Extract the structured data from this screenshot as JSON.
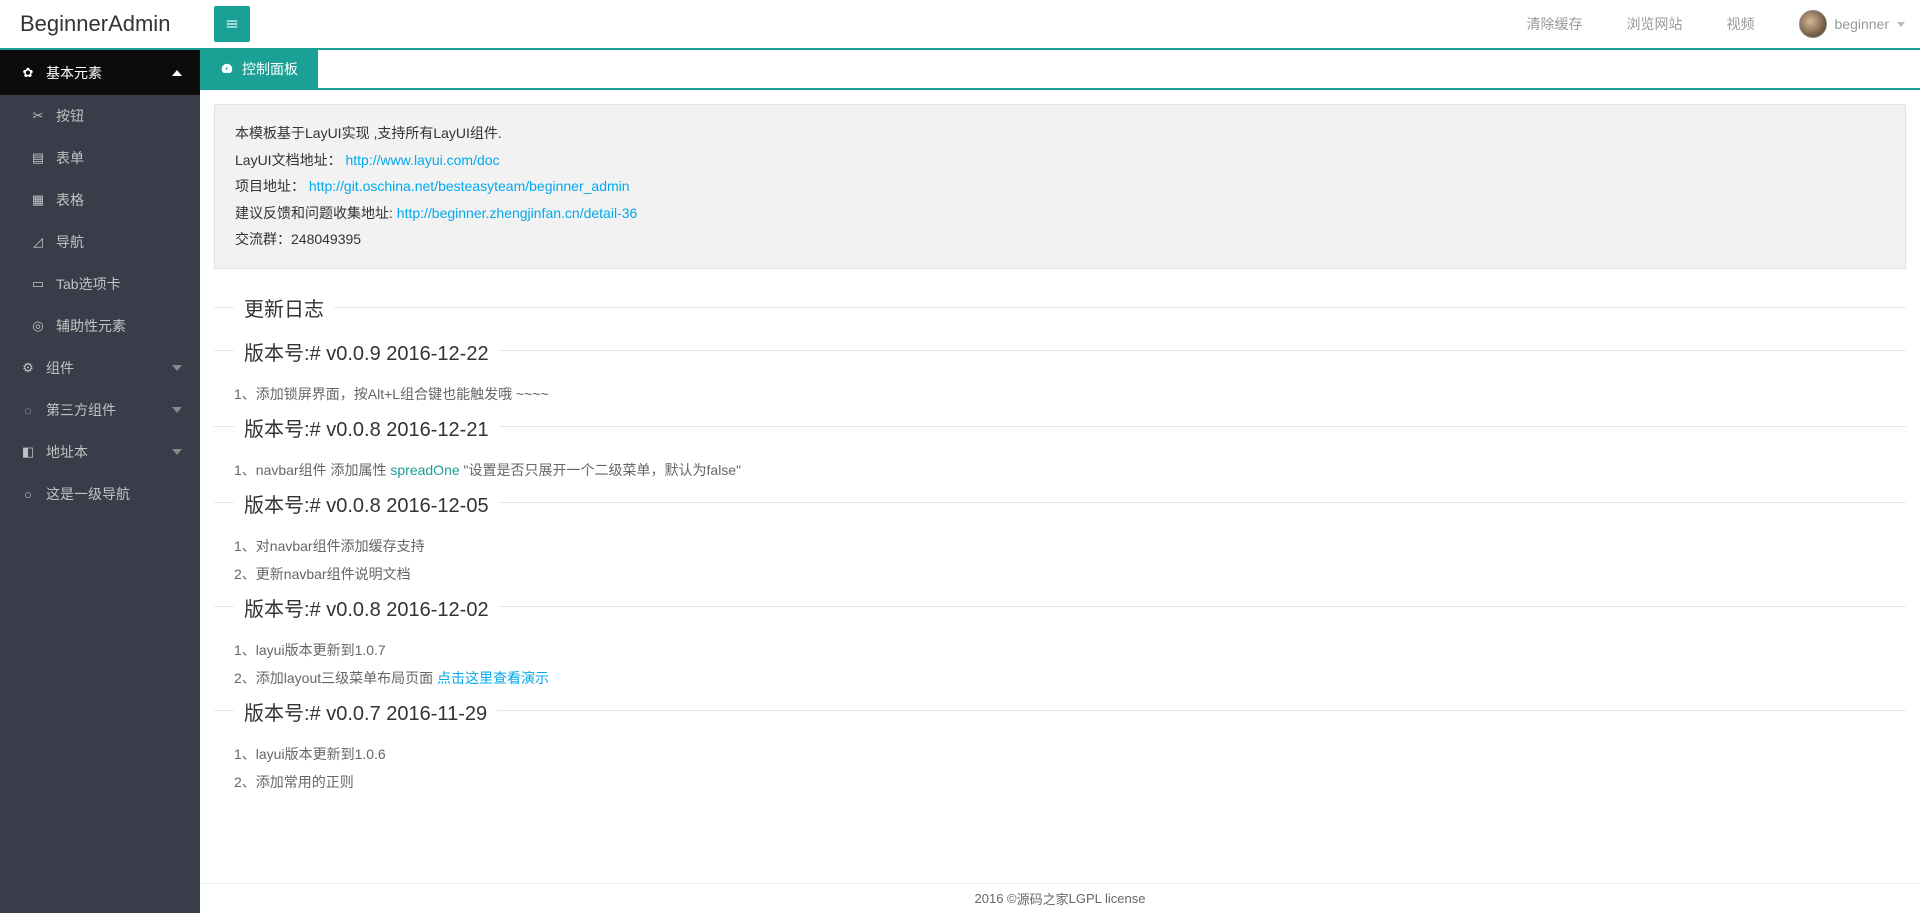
{
  "header": {
    "logo": "BeginnerAdmin",
    "links": [
      "清除缓存",
      "浏览网站",
      "视频"
    ],
    "username": "beginner"
  },
  "sidebar": {
    "groups": [
      {
        "label": "基本元素",
        "expanded": true,
        "children": [
          {
            "label": "按钮"
          },
          {
            "label": "表单"
          },
          {
            "label": "表格"
          },
          {
            "label": "导航"
          },
          {
            "label": "Tab选项卡"
          },
          {
            "label": "辅助性元素"
          }
        ]
      },
      {
        "label": "组件",
        "expanded": false,
        "children": []
      },
      {
        "label": "第三方组件",
        "expanded": false,
        "children": []
      },
      {
        "label": "地址本",
        "expanded": false,
        "children": []
      },
      {
        "label": "这是一级导航",
        "expanded": false,
        "no_arrow": true,
        "children": []
      }
    ]
  },
  "tabs": {
    "active": "控制面板"
  },
  "notice": {
    "line1": "本模板基于LayUI实现 ,支持所有LayUI组件.",
    "line2_label": "LayUI文档地址：",
    "line2_link": "http://www.layui.com/doc",
    "line3_label": "项目地址：",
    "line3_link": "http://git.oschina.net/besteasyteam/beginner_admin",
    "line4_label": "建议反馈和问题收集地址:",
    "line4_link": "http://beginner.zhengjinfan.cn/detail-36",
    "line5": "交流群：248049395"
  },
  "changelog": {
    "title": "更新日志",
    "versions": [
      {
        "title": "版本号:# v0.0.9 2016-12-22",
        "items": [
          {
            "text": "1、添加锁屏界面，按Alt+L组合键也能触发哦 ~~~~"
          }
        ]
      },
      {
        "title": "版本号:# v0.0.8 2016-12-21",
        "items": [
          {
            "text_prefix": "1、navbar组件 添加属性 ",
            "highlight": "spreadOne",
            "text_suffix": " \"设置是否只展开一个二级菜单，默认为false\""
          }
        ]
      },
      {
        "title": "版本号:# v0.0.8 2016-12-05",
        "items": [
          {
            "text": "1、对navbar组件添加缓存支持"
          },
          {
            "text": "2、更新navbar组件说明文档"
          }
        ]
      },
      {
        "title": "版本号:# v0.0.8 2016-12-02",
        "items": [
          {
            "text": "1、layui版本更新到1.0.7"
          },
          {
            "text_prefix": "2、添加layout三级菜单布局页面 ",
            "link": "点击这里查看演示"
          }
        ]
      },
      {
        "title": "版本号:# v0.0.7 2016-11-29",
        "items": [
          {
            "text": "1、layui版本更新到1.0.6"
          },
          {
            "text": "2、添加常用的正则"
          }
        ]
      }
    ]
  },
  "footer": {
    "year": "2016 © ",
    "site": "源码之家",
    "license": "  LGPL license"
  }
}
